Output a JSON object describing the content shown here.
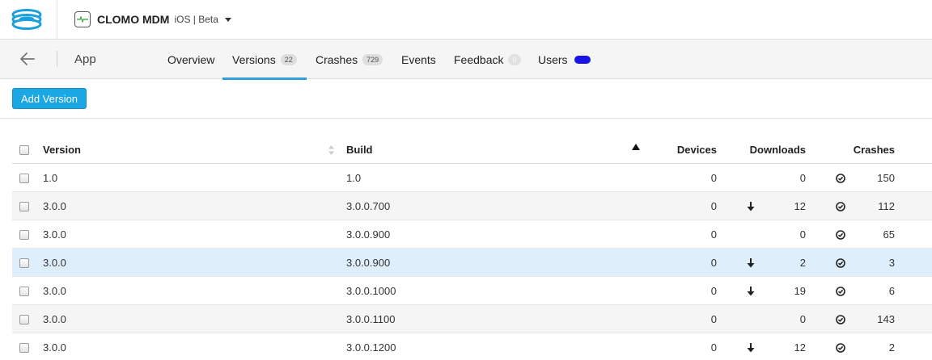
{
  "header": {
    "app_name": "CLOMO MDM",
    "app_platform": "iOS | Beta"
  },
  "subnav": {
    "section_title": "App",
    "tabs": [
      {
        "label": "Overview"
      },
      {
        "label": "Versions",
        "count": "22"
      },
      {
        "label": "Crashes",
        "count": "729"
      },
      {
        "label": "Events"
      },
      {
        "label": "Feedback",
        "count": "0"
      },
      {
        "label": "Users"
      }
    ]
  },
  "toolbar": {
    "add_version_label": "Add Version"
  },
  "table": {
    "columns": {
      "version": "Version",
      "build": "Build",
      "devices": "Devices",
      "downloads": "Downloads",
      "crashes": "Crashes"
    },
    "rows": [
      {
        "version": "1.0",
        "build": "1.0",
        "devices": "0",
        "downloads": "0",
        "crashes": "150"
      },
      {
        "version": "3.0.0",
        "build": "3.0.0.700",
        "devices": "0",
        "downloads": "12",
        "crashes": "112"
      },
      {
        "version": "3.0.0",
        "build": "3.0.0.900",
        "devices": "0",
        "downloads": "0",
        "crashes": "65"
      },
      {
        "version": "3.0.0",
        "build": "3.0.0.900",
        "devices": "0",
        "downloads": "2",
        "crashes": "3"
      },
      {
        "version": "3.0.0",
        "build": "3.0.0.1000",
        "devices": "0",
        "downloads": "19",
        "crashes": "6"
      },
      {
        "version": "3.0.0",
        "build": "3.0.0.1100",
        "devices": "0",
        "downloads": "0",
        "crashes": "143"
      },
      {
        "version": "3.0.0",
        "build": "3.0.0.1200",
        "devices": "0",
        "downloads": "12",
        "crashes": "2"
      }
    ]
  },
  "icons": {
    "logo": "stacked-disc-logo-icon",
    "back": "arrow-left-icon",
    "download": "download-arrow-icon",
    "crash_status": "check-circle-icon",
    "sort": "sort-icon"
  },
  "colors": {
    "accent": "#2e9fd8",
    "button": "#1ba6e4",
    "users_indicator": "#1a14e8",
    "selected_row": "#dfeefb"
  }
}
